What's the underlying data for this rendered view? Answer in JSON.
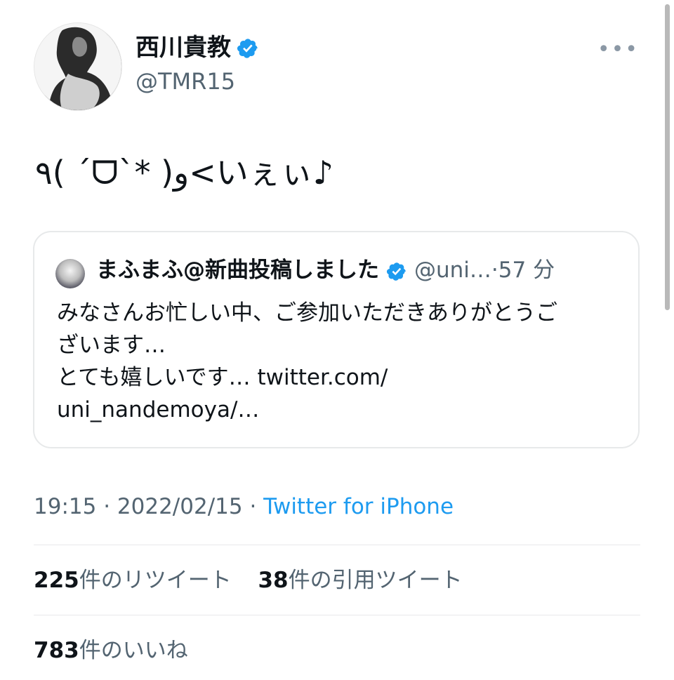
{
  "author": {
    "display_name": "西川貴教",
    "handle": "@TMR15"
  },
  "more_label": "•••",
  "tweet_text": "٩( ´ᗜ`* )و<いぇぃ♪",
  "quote": {
    "display_name": "まふまふ@新曲投稿しました",
    "handle": "@uni…",
    "separator": "·",
    "time": "57 分",
    "text_lines": [
      "みなさんお忙しい中、ご参加いただきありがとうご",
      "ざいます…",
      "とても嬉しいです… twitter.com/",
      "uni_nandemoya/…"
    ]
  },
  "meta": {
    "time": "19:15",
    "sep1": " · ",
    "date": "2022/02/15",
    "sep2": " · ",
    "source": "Twitter for iPhone"
  },
  "stats": {
    "retweets_count": "225",
    "retweets_label": "件のリツイート",
    "quotes_count": "38",
    "quotes_label": "件の引用ツイート",
    "likes_count": "783",
    "likes_label": "件のいいね"
  },
  "colors": {
    "verified": "#1d9bf0",
    "link": "#1d9bf0",
    "secondary_text": "#536471",
    "divider": "#e7e9ea"
  }
}
